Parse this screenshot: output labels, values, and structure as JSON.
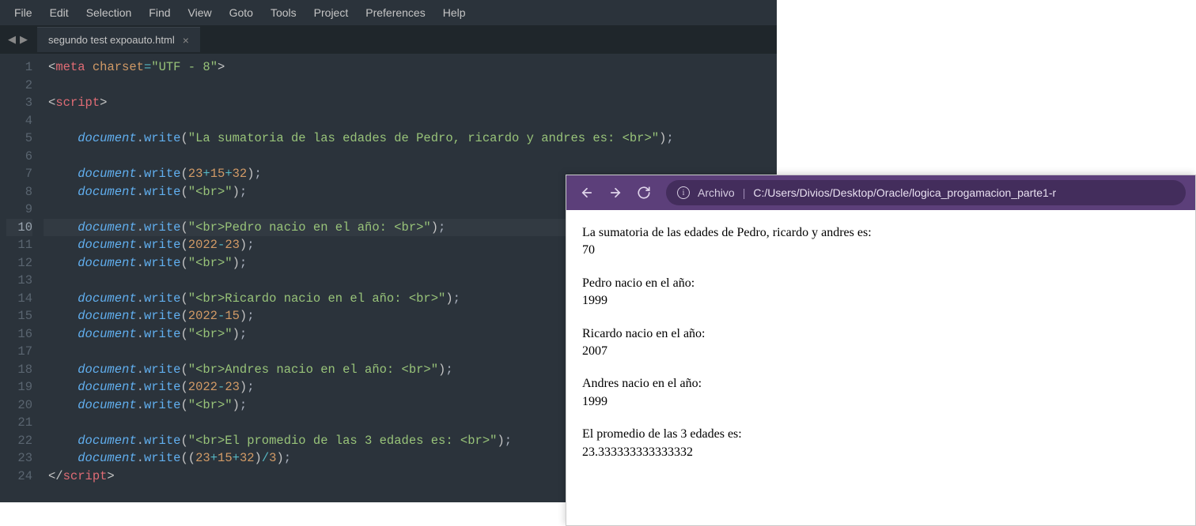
{
  "editor": {
    "menu": [
      "File",
      "Edit",
      "Selection",
      "Find",
      "View",
      "Goto",
      "Tools",
      "Project",
      "Preferences",
      "Help"
    ],
    "tab_name": "segundo test expoauto.html",
    "active_line": 10,
    "lines": [
      {
        "n": 1,
        "indent": "",
        "tokens": [
          {
            "c": "tag-bracket",
            "t": "<"
          },
          {
            "c": "tag-name",
            "t": "meta"
          },
          {
            "c": "",
            "t": " "
          },
          {
            "c": "attr-name",
            "t": "charset"
          },
          {
            "c": "operator",
            "t": "="
          },
          {
            "c": "string",
            "t": "\"UTF - 8\""
          },
          {
            "c": "tag-bracket",
            "t": ">"
          }
        ]
      },
      {
        "n": 2,
        "indent": "",
        "tokens": []
      },
      {
        "n": 3,
        "indent": "",
        "tokens": [
          {
            "c": "tag-bracket",
            "t": "<"
          },
          {
            "c": "tag-name",
            "t": "script"
          },
          {
            "c": "tag-bracket",
            "t": ">"
          }
        ]
      },
      {
        "n": 4,
        "indent": "",
        "tokens": []
      },
      {
        "n": 5,
        "indent": "    ",
        "tokens": [
          {
            "c": "variable",
            "t": "document"
          },
          {
            "c": "dot",
            "t": "."
          },
          {
            "c": "method",
            "t": "write"
          },
          {
            "c": "paren",
            "t": "("
          },
          {
            "c": "string",
            "t": "\"La sumatoria de las edades de Pedro, ricardo y andres es: <br>\""
          },
          {
            "c": "paren",
            "t": ")"
          },
          {
            "c": "semicolon",
            "t": ";"
          }
        ]
      },
      {
        "n": 6,
        "indent": "",
        "tokens": []
      },
      {
        "n": 7,
        "indent": "    ",
        "tokens": [
          {
            "c": "variable",
            "t": "document"
          },
          {
            "c": "dot",
            "t": "."
          },
          {
            "c": "method",
            "t": "write"
          },
          {
            "c": "paren",
            "t": "("
          },
          {
            "c": "number",
            "t": "23"
          },
          {
            "c": "operator",
            "t": "+"
          },
          {
            "c": "number",
            "t": "15"
          },
          {
            "c": "operator",
            "t": "+"
          },
          {
            "c": "number",
            "t": "32"
          },
          {
            "c": "paren",
            "t": ")"
          },
          {
            "c": "semicolon",
            "t": ";"
          }
        ]
      },
      {
        "n": 8,
        "indent": "    ",
        "tokens": [
          {
            "c": "variable",
            "t": "document"
          },
          {
            "c": "dot",
            "t": "."
          },
          {
            "c": "method",
            "t": "write"
          },
          {
            "c": "paren",
            "t": "("
          },
          {
            "c": "string",
            "t": "\"<br>\""
          },
          {
            "c": "paren",
            "t": ")"
          },
          {
            "c": "semicolon",
            "t": ";"
          }
        ]
      },
      {
        "n": 9,
        "indent": "",
        "tokens": []
      },
      {
        "n": 10,
        "indent": "    ",
        "tokens": [
          {
            "c": "variable",
            "t": "document"
          },
          {
            "c": "dot",
            "t": "."
          },
          {
            "c": "method",
            "t": "write"
          },
          {
            "c": "paren",
            "t": "("
          },
          {
            "c": "string",
            "t": "\"<br>Pedro nacio en el año: <br>\""
          },
          {
            "c": "paren",
            "t": ")"
          },
          {
            "c": "semicolon",
            "t": ";"
          }
        ]
      },
      {
        "n": 11,
        "indent": "    ",
        "tokens": [
          {
            "c": "variable",
            "t": "document"
          },
          {
            "c": "dot",
            "t": "."
          },
          {
            "c": "method",
            "t": "write"
          },
          {
            "c": "paren",
            "t": "("
          },
          {
            "c": "number",
            "t": "2022"
          },
          {
            "c": "operator",
            "t": "-"
          },
          {
            "c": "number",
            "t": "23"
          },
          {
            "c": "paren",
            "t": ")"
          },
          {
            "c": "semicolon",
            "t": ";"
          }
        ]
      },
      {
        "n": 12,
        "indent": "    ",
        "tokens": [
          {
            "c": "variable",
            "t": "document"
          },
          {
            "c": "dot",
            "t": "."
          },
          {
            "c": "method",
            "t": "write"
          },
          {
            "c": "paren",
            "t": "("
          },
          {
            "c": "string",
            "t": "\"<br>\""
          },
          {
            "c": "paren",
            "t": ")"
          },
          {
            "c": "semicolon",
            "t": ";"
          }
        ]
      },
      {
        "n": 13,
        "indent": "",
        "tokens": []
      },
      {
        "n": 14,
        "indent": "    ",
        "tokens": [
          {
            "c": "variable",
            "t": "document"
          },
          {
            "c": "dot",
            "t": "."
          },
          {
            "c": "method",
            "t": "write"
          },
          {
            "c": "paren",
            "t": "("
          },
          {
            "c": "string",
            "t": "\"<br>Ricardo nacio en el año: <br>\""
          },
          {
            "c": "paren",
            "t": ")"
          },
          {
            "c": "semicolon",
            "t": ";"
          }
        ]
      },
      {
        "n": 15,
        "indent": "    ",
        "tokens": [
          {
            "c": "variable",
            "t": "document"
          },
          {
            "c": "dot",
            "t": "."
          },
          {
            "c": "method",
            "t": "write"
          },
          {
            "c": "paren",
            "t": "("
          },
          {
            "c": "number",
            "t": "2022"
          },
          {
            "c": "operator",
            "t": "-"
          },
          {
            "c": "number",
            "t": "15"
          },
          {
            "c": "paren",
            "t": ")"
          },
          {
            "c": "semicolon",
            "t": ";"
          }
        ]
      },
      {
        "n": 16,
        "indent": "    ",
        "tokens": [
          {
            "c": "variable",
            "t": "document"
          },
          {
            "c": "dot",
            "t": "."
          },
          {
            "c": "method",
            "t": "write"
          },
          {
            "c": "paren",
            "t": "("
          },
          {
            "c": "string",
            "t": "\"<br>\""
          },
          {
            "c": "paren",
            "t": ")"
          },
          {
            "c": "semicolon",
            "t": ";"
          }
        ]
      },
      {
        "n": 17,
        "indent": "",
        "tokens": []
      },
      {
        "n": 18,
        "indent": "    ",
        "tokens": [
          {
            "c": "variable",
            "t": "document"
          },
          {
            "c": "dot",
            "t": "."
          },
          {
            "c": "method",
            "t": "write"
          },
          {
            "c": "paren",
            "t": "("
          },
          {
            "c": "string",
            "t": "\"<br>Andres nacio en el año: <br>\""
          },
          {
            "c": "paren",
            "t": ")"
          },
          {
            "c": "semicolon",
            "t": ";"
          }
        ]
      },
      {
        "n": 19,
        "indent": "    ",
        "tokens": [
          {
            "c": "variable",
            "t": "document"
          },
          {
            "c": "dot",
            "t": "."
          },
          {
            "c": "method",
            "t": "write"
          },
          {
            "c": "paren",
            "t": "("
          },
          {
            "c": "number",
            "t": "2022"
          },
          {
            "c": "operator",
            "t": "-"
          },
          {
            "c": "number",
            "t": "23"
          },
          {
            "c": "paren",
            "t": ")"
          },
          {
            "c": "semicolon",
            "t": ";"
          }
        ]
      },
      {
        "n": 20,
        "indent": "    ",
        "tokens": [
          {
            "c": "variable",
            "t": "document"
          },
          {
            "c": "dot",
            "t": "."
          },
          {
            "c": "method",
            "t": "write"
          },
          {
            "c": "paren",
            "t": "("
          },
          {
            "c": "string",
            "t": "\"<br>\""
          },
          {
            "c": "paren",
            "t": ")"
          },
          {
            "c": "semicolon",
            "t": ";"
          }
        ]
      },
      {
        "n": 21,
        "indent": "",
        "tokens": []
      },
      {
        "n": 22,
        "indent": "    ",
        "tokens": [
          {
            "c": "variable",
            "t": "document"
          },
          {
            "c": "dot",
            "t": "."
          },
          {
            "c": "method",
            "t": "write"
          },
          {
            "c": "paren",
            "t": "("
          },
          {
            "c": "string",
            "t": "\"<br>El promedio de las 3 edades es: <br>\""
          },
          {
            "c": "paren",
            "t": ")"
          },
          {
            "c": "semicolon",
            "t": ";"
          }
        ]
      },
      {
        "n": 23,
        "indent": "    ",
        "tokens": [
          {
            "c": "variable",
            "t": "document"
          },
          {
            "c": "dot",
            "t": "."
          },
          {
            "c": "method",
            "t": "write"
          },
          {
            "c": "paren",
            "t": "("
          },
          {
            "c": "paren",
            "t": "("
          },
          {
            "c": "number",
            "t": "23"
          },
          {
            "c": "operator",
            "t": "+"
          },
          {
            "c": "number",
            "t": "15"
          },
          {
            "c": "operator",
            "t": "+"
          },
          {
            "c": "number",
            "t": "32"
          },
          {
            "c": "paren",
            "t": ")"
          },
          {
            "c": "operator",
            "t": "/"
          },
          {
            "c": "number",
            "t": "3"
          },
          {
            "c": "paren",
            "t": ")"
          },
          {
            "c": "semicolon",
            "t": ";"
          }
        ]
      },
      {
        "n": 24,
        "indent": "",
        "tokens": [
          {
            "c": "tag-bracket",
            "t": "</"
          },
          {
            "c": "tag-name",
            "t": "script"
          },
          {
            "c": "tag-bracket",
            "t": ">"
          }
        ]
      }
    ]
  },
  "browser": {
    "address_label": "Archivo",
    "address_path": "C:/Users/Divios/Desktop/Oracle/logica_progamacion_parte1-r",
    "output": [
      {
        "lines": [
          "La sumatoria de las edades de Pedro, ricardo y andres es:",
          "70"
        ]
      },
      {
        "lines": [
          "Pedro nacio en el año:",
          "1999"
        ]
      },
      {
        "lines": [
          "Ricardo nacio en el año:",
          "2007"
        ]
      },
      {
        "lines": [
          "Andres nacio en el año:",
          "1999"
        ]
      },
      {
        "lines": [
          "El promedio de las 3 edades es:",
          "23.333333333333332"
        ]
      }
    ]
  }
}
